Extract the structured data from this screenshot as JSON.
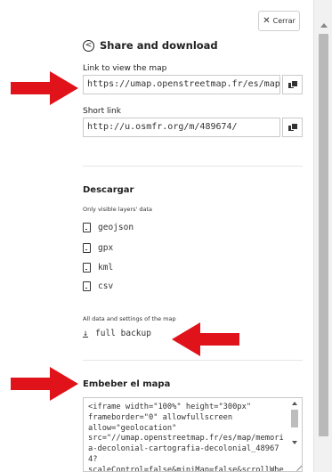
{
  "close_button": {
    "label": "Cerrar"
  },
  "header": {
    "title": "Share and download"
  },
  "link_section": {
    "label": "Link to view the map",
    "value": "https://umap.openstreetmap.fr/es/map/memor"
  },
  "short_link_section": {
    "label": "Short link",
    "value": "http://u.osmfr.org/m/489674/"
  },
  "download": {
    "title": "Descargar",
    "note": "Only visible layers' data",
    "formats": [
      "geojson",
      "gpx",
      "kml",
      "csv"
    ],
    "all_data_note": "All data and settings of the map",
    "backup_label": "full backup"
  },
  "embed": {
    "title": "Embeber el mapa",
    "code": "<iframe width=\"100%\" height=\"300px\"\nframeborder=\"0\" allowfullscreen\nallow=\"geolocation\"\nsrc=\"//umap.openstreetmap.fr/es/map/memori\na-decolonial-cartografia-decolonial_489674?\nscaleControl=false&miniMap=false&scrollWheel"
  },
  "colors": {
    "arrow": "#e0131b",
    "accent_text": "#222222"
  },
  "icons": [
    "close-icon",
    "share-icon",
    "copy-icon",
    "file-download-icon",
    "download-icon"
  ]
}
